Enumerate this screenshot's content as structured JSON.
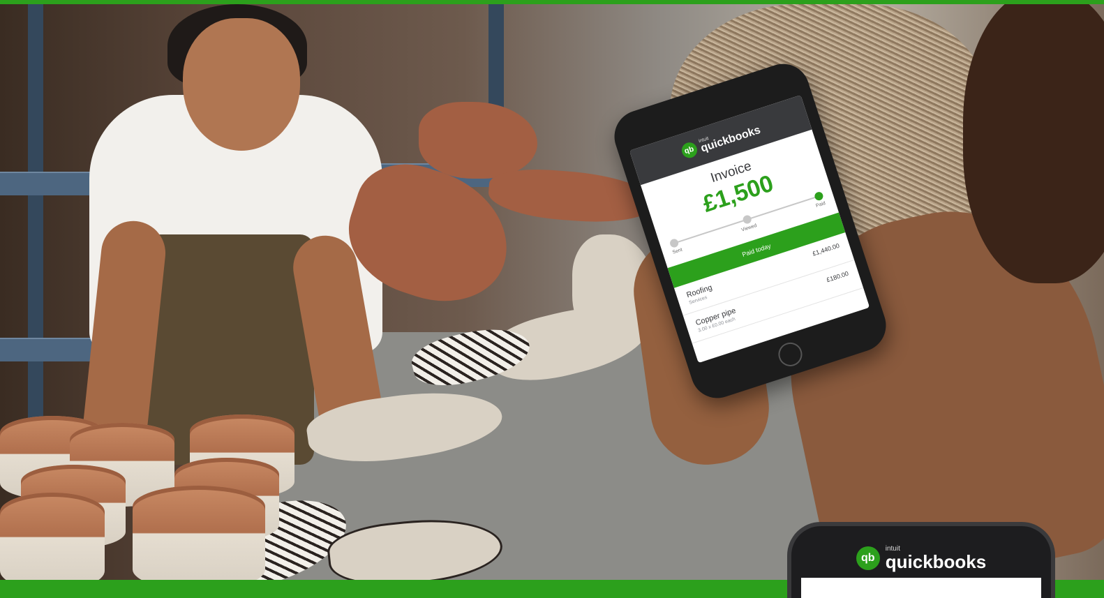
{
  "phone_main": {
    "brand_small": "intuit",
    "brand_name": "quickbooks",
    "logo_text": "qb",
    "invoice_title": "Invoice",
    "invoice_amount": "£1,500",
    "steps": [
      "Sent",
      "Viewed",
      "Paid"
    ],
    "cta_label": "Paid today",
    "line_items": [
      {
        "name": "Roofing",
        "sub": "Services",
        "amount": "£1,440.00"
      },
      {
        "name": "Copper pipe",
        "sub": "3.00 x £0.00 each",
        "amount": "£180.00"
      }
    ]
  },
  "phone_secondary": {
    "logo_text": "qb",
    "brand_small": "intuit",
    "brand_name": "quickbooks"
  },
  "colors": {
    "brand_green": "#2ca01c",
    "header_dark": "#393a3d"
  }
}
